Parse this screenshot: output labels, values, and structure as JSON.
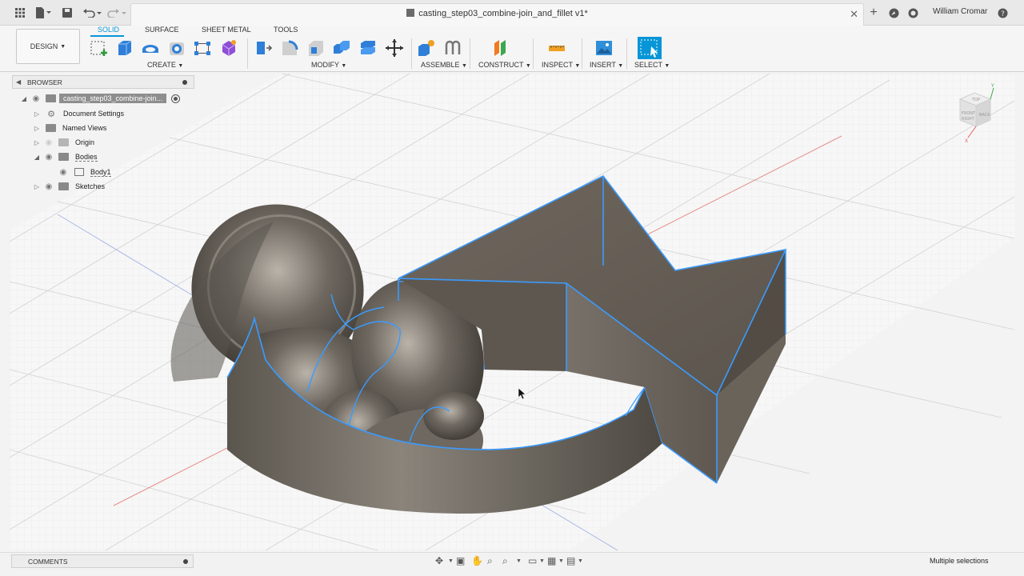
{
  "titlebar": {
    "document_title": "casting_step03_combine-join_and_fillet v1*",
    "user": "William Cromar",
    "icons": [
      "grid-icon",
      "file-icon",
      "save-icon",
      "undo-icon",
      "redo-icon",
      "close-icon",
      "new-tab-icon",
      "extensions-icon",
      "job-status-icon",
      "help-icon"
    ]
  },
  "ribbon": {
    "workspace": "DESIGN",
    "tabs": [
      "SOLID",
      "SURFACE",
      "SHEET METAL",
      "TOOLS"
    ],
    "active_tab": "SOLID",
    "groups": {
      "create": "CREATE",
      "modify": "MODIFY",
      "assemble": "ASSEMBLE",
      "construct": "CONSTRUCT",
      "inspect": "INSPECT",
      "insert": "INSERT",
      "select": "SELECT"
    },
    "accent": "#0696d7"
  },
  "browser": {
    "title": "BROWSER",
    "root": "casting_step03_combine-join...",
    "items": [
      {
        "label": "Document Settings"
      },
      {
        "label": "Named Views"
      },
      {
        "label": "Origin"
      },
      {
        "label": "Bodies"
      },
      {
        "label": "Body1"
      },
      {
        "label": "Sketches"
      }
    ]
  },
  "viewcube": {
    "faces": [
      "TOP",
      "FRONT",
      "RIGHT",
      "BACK"
    ],
    "axes": [
      "Y",
      "X"
    ]
  },
  "bottom": {
    "comments": "COMMENTS",
    "status": "Multiple selections"
  },
  "colors": {
    "model_body": "#6e6860",
    "selection_edge": "#3a9bff",
    "grid": "#d8d8d8",
    "axis_red": "#e06060",
    "axis_blue": "#7a8fe0"
  }
}
